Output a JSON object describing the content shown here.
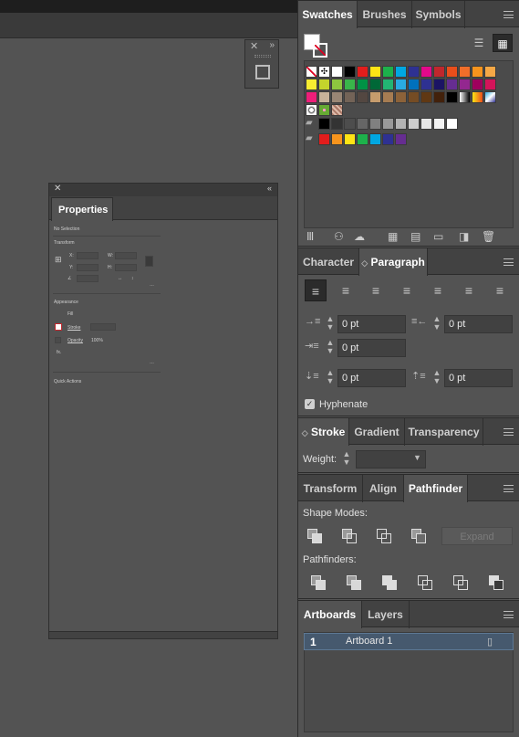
{
  "swatches_panel": {
    "tabs": [
      "Swatches",
      "Brushes",
      "Symbols"
    ],
    "rows": [
      [
        "none",
        "registration",
        "#ffffff",
        "#000000",
        "#e31d1c",
        "#ffe415",
        "#1db14b",
        "#00a7e2",
        "#2e3192",
        "#e2098a",
        "#c0272d",
        "#e94e1b",
        "#f06e2a",
        "#f7941d",
        "#f6a846"
      ],
      [
        "#f8ed31",
        "#c4d42c",
        "#8dc63f",
        "#39b54a",
        "#009245",
        "#006837",
        "#22b573",
        "#29abe2",
        "#0071bc",
        "#2e3192",
        "#1b1464",
        "#662d91",
        "#93278f",
        "#9e005d",
        "#d4145a"
      ],
      [
        "#ed1e79",
        "#c7b299",
        "#998675",
        "#736357",
        "#534741",
        "#c69c6d",
        "#a67c52",
        "#8c6239",
        "#754c24",
        "#603813",
        "#42210b",
        "#000000",
        "grad-bw",
        "grad-orange",
        "grad-blue"
      ],
      [
        "pattern1",
        "pattern2",
        "pattern3"
      ],
      [
        "folder",
        "#000000",
        "#333333",
        "#4d4d4d",
        "#666666",
        "#808080",
        "#999999",
        "#b3b3b3",
        "#cccccc",
        "#e6e6e6",
        "#f2f2f2",
        "#ffffff"
      ],
      [
        "folder",
        "#e31d1c",
        "#f7941d",
        "#ffe415",
        "#1db14b",
        "#00a7e2",
        "#2e3192",
        "#662d91"
      ]
    ],
    "footer_icons": [
      "library-icon",
      "show-kinds-icon",
      "cloud-swatch-icon",
      "color-group-icon",
      "swatch-options-icon",
      "new-folder-icon",
      "new-swatch-icon",
      "delete-icon"
    ]
  },
  "typography": {
    "tabs": [
      "Character",
      "Paragraph"
    ],
    "left_indent": "0 pt",
    "right_indent": "0 pt",
    "first_line_indent": "0 pt",
    "space_before": "0 pt",
    "space_after": "0 pt",
    "hyphenate": "Hyphenate"
  },
  "stroke_panel": {
    "tabs": [
      "Stroke",
      "Gradient",
      "Transparency"
    ],
    "weight_label": "Weight:"
  },
  "pathfinder_panel": {
    "tabs": [
      "Transform",
      "Align",
      "Pathfinder"
    ],
    "shape_modes_label": "Shape Modes:",
    "expand_label": "Expand",
    "pathfinders_label": "Pathfinders:"
  },
  "artboards_panel": {
    "tabs": [
      "Artboards",
      "Layers"
    ],
    "rows": [
      {
        "number": "1",
        "name": "Artboard 1"
      }
    ]
  },
  "properties_panel": {
    "tab": "Properties",
    "no_selection": "No Selection",
    "transform": "Transform",
    "x_label": "X:",
    "y_label": "Y:",
    "w_label": "W:",
    "h_label": "H:",
    "appearance": "Appearance",
    "fill": "Fill",
    "stroke": "Stroke",
    "opacity": "Opacity",
    "opacity_value": "100%",
    "fx": "fx.",
    "quick_actions": "Quick Actions"
  }
}
